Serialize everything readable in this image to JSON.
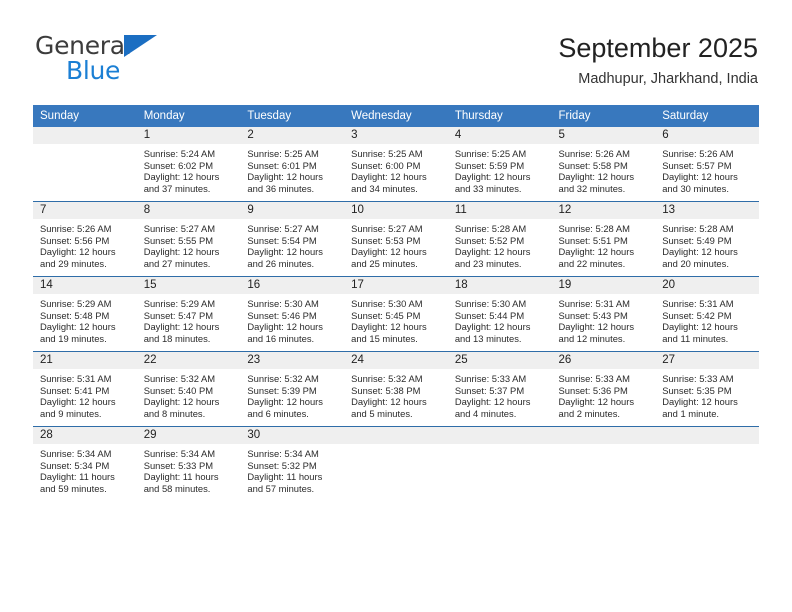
{
  "brand": {
    "name_top": "General",
    "name_bottom": "Blue",
    "triangle_color": "#1b6ec2",
    "text_color": "#3c3c3c",
    "accent_color": "#1b7fd4"
  },
  "header": {
    "title": "September 2025",
    "subtitle": "Madhupur, Jharkhand, India"
  },
  "theme": {
    "header_bg": "#3878be",
    "daynum_bg": "#efefef",
    "row_border": "#2f6da8",
    "text": "#222222"
  },
  "calendar": {
    "weekday_headers": [
      "Sunday",
      "Monday",
      "Tuesday",
      "Wednesday",
      "Thursday",
      "Friday",
      "Saturday"
    ],
    "weeks": [
      [
        {
          "day": "",
          "lines": []
        },
        {
          "day": "1",
          "lines": [
            "Sunrise: 5:24 AM",
            "Sunset: 6:02 PM",
            "Daylight: 12 hours",
            "and 37 minutes."
          ]
        },
        {
          "day": "2",
          "lines": [
            "Sunrise: 5:25 AM",
            "Sunset: 6:01 PM",
            "Daylight: 12 hours",
            "and 36 minutes."
          ]
        },
        {
          "day": "3",
          "lines": [
            "Sunrise: 5:25 AM",
            "Sunset: 6:00 PM",
            "Daylight: 12 hours",
            "and 34 minutes."
          ]
        },
        {
          "day": "4",
          "lines": [
            "Sunrise: 5:25 AM",
            "Sunset: 5:59 PM",
            "Daylight: 12 hours",
            "and 33 minutes."
          ]
        },
        {
          "day": "5",
          "lines": [
            "Sunrise: 5:26 AM",
            "Sunset: 5:58 PM",
            "Daylight: 12 hours",
            "and 32 minutes."
          ]
        },
        {
          "day": "6",
          "lines": [
            "Sunrise: 5:26 AM",
            "Sunset: 5:57 PM",
            "Daylight: 12 hours",
            "and 30 minutes."
          ]
        }
      ],
      [
        {
          "day": "7",
          "lines": [
            "Sunrise: 5:26 AM",
            "Sunset: 5:56 PM",
            "Daylight: 12 hours",
            "and 29 minutes."
          ]
        },
        {
          "day": "8",
          "lines": [
            "Sunrise: 5:27 AM",
            "Sunset: 5:55 PM",
            "Daylight: 12 hours",
            "and 27 minutes."
          ]
        },
        {
          "day": "9",
          "lines": [
            "Sunrise: 5:27 AM",
            "Sunset: 5:54 PM",
            "Daylight: 12 hours",
            "and 26 minutes."
          ]
        },
        {
          "day": "10",
          "lines": [
            "Sunrise: 5:27 AM",
            "Sunset: 5:53 PM",
            "Daylight: 12 hours",
            "and 25 minutes."
          ]
        },
        {
          "day": "11",
          "lines": [
            "Sunrise: 5:28 AM",
            "Sunset: 5:52 PM",
            "Daylight: 12 hours",
            "and 23 minutes."
          ]
        },
        {
          "day": "12",
          "lines": [
            "Sunrise: 5:28 AM",
            "Sunset: 5:51 PM",
            "Daylight: 12 hours",
            "and 22 minutes."
          ]
        },
        {
          "day": "13",
          "lines": [
            "Sunrise: 5:28 AM",
            "Sunset: 5:49 PM",
            "Daylight: 12 hours",
            "and 20 minutes."
          ]
        }
      ],
      [
        {
          "day": "14",
          "lines": [
            "Sunrise: 5:29 AM",
            "Sunset: 5:48 PM",
            "Daylight: 12 hours",
            "and 19 minutes."
          ]
        },
        {
          "day": "15",
          "lines": [
            "Sunrise: 5:29 AM",
            "Sunset: 5:47 PM",
            "Daylight: 12 hours",
            "and 18 minutes."
          ]
        },
        {
          "day": "16",
          "lines": [
            "Sunrise: 5:30 AM",
            "Sunset: 5:46 PM",
            "Daylight: 12 hours",
            "and 16 minutes."
          ]
        },
        {
          "day": "17",
          "lines": [
            "Sunrise: 5:30 AM",
            "Sunset: 5:45 PM",
            "Daylight: 12 hours",
            "and 15 minutes."
          ]
        },
        {
          "day": "18",
          "lines": [
            "Sunrise: 5:30 AM",
            "Sunset: 5:44 PM",
            "Daylight: 12 hours",
            "and 13 minutes."
          ]
        },
        {
          "day": "19",
          "lines": [
            "Sunrise: 5:31 AM",
            "Sunset: 5:43 PM",
            "Daylight: 12 hours",
            "and 12 minutes."
          ]
        },
        {
          "day": "20",
          "lines": [
            "Sunrise: 5:31 AM",
            "Sunset: 5:42 PM",
            "Daylight: 12 hours",
            "and 11 minutes."
          ]
        }
      ],
      [
        {
          "day": "21",
          "lines": [
            "Sunrise: 5:31 AM",
            "Sunset: 5:41 PM",
            "Daylight: 12 hours",
            "and 9 minutes."
          ]
        },
        {
          "day": "22",
          "lines": [
            "Sunrise: 5:32 AM",
            "Sunset: 5:40 PM",
            "Daylight: 12 hours",
            "and 8 minutes."
          ]
        },
        {
          "day": "23",
          "lines": [
            "Sunrise: 5:32 AM",
            "Sunset: 5:39 PM",
            "Daylight: 12 hours",
            "and 6 minutes."
          ]
        },
        {
          "day": "24",
          "lines": [
            "Sunrise: 5:32 AM",
            "Sunset: 5:38 PM",
            "Daylight: 12 hours",
            "and 5 minutes."
          ]
        },
        {
          "day": "25",
          "lines": [
            "Sunrise: 5:33 AM",
            "Sunset: 5:37 PM",
            "Daylight: 12 hours",
            "and 4 minutes."
          ]
        },
        {
          "day": "26",
          "lines": [
            "Sunrise: 5:33 AM",
            "Sunset: 5:36 PM",
            "Daylight: 12 hours",
            "and 2 minutes."
          ]
        },
        {
          "day": "27",
          "lines": [
            "Sunrise: 5:33 AM",
            "Sunset: 5:35 PM",
            "Daylight: 12 hours",
            "and 1 minute."
          ]
        }
      ],
      [
        {
          "day": "28",
          "lines": [
            "Sunrise: 5:34 AM",
            "Sunset: 5:34 PM",
            "Daylight: 11 hours",
            "and 59 minutes."
          ]
        },
        {
          "day": "29",
          "lines": [
            "Sunrise: 5:34 AM",
            "Sunset: 5:33 PM",
            "Daylight: 11 hours",
            "and 58 minutes."
          ]
        },
        {
          "day": "30",
          "lines": [
            "Sunrise: 5:34 AM",
            "Sunset: 5:32 PM",
            "Daylight: 11 hours",
            "and 57 minutes."
          ]
        },
        {
          "day": "",
          "lines": []
        },
        {
          "day": "",
          "lines": []
        },
        {
          "day": "",
          "lines": []
        },
        {
          "day": "",
          "lines": []
        }
      ]
    ]
  }
}
